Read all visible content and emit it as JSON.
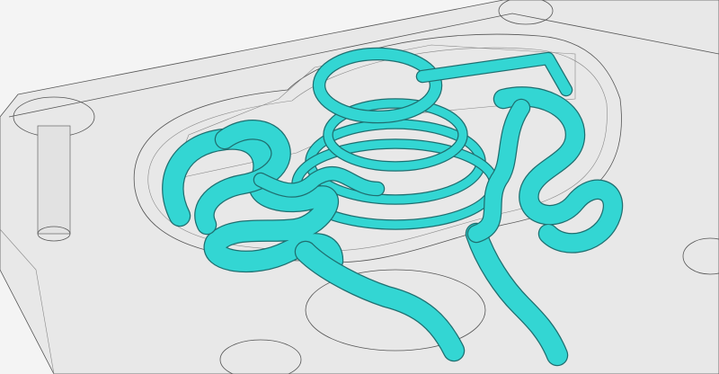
{
  "colors": {
    "background": "#f4f4f4",
    "plate": "#e6e6e6",
    "channel": "#33d6d3",
    "channel_outline": "#1f6f70",
    "edge": "#555555"
  }
}
